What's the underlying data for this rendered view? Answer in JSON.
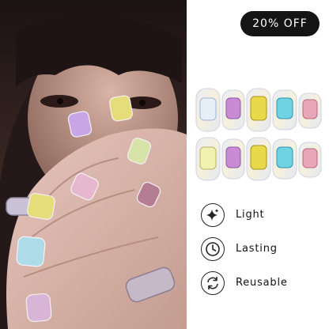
{
  "badge": {
    "text": "20% OFF"
  },
  "features": [
    {
      "icon": "sparkle-icon",
      "label": "Light"
    },
    {
      "icon": "clock-icon",
      "label": "Lasting"
    },
    {
      "icon": "refresh-icon",
      "label": "Reusable"
    }
  ],
  "colors": {
    "badge_bg": "#141414",
    "gem_yellow": "#e9d84a",
    "gem_purple": "#c98bd6",
    "gem_cyan": "#6fd3e3",
    "gem_pink": "#e8a6b8"
  },
  "product": {
    "rows": [
      {
        "gems": [
          "clear-iridescent",
          "purple",
          "yellow",
          "cyan",
          "pink"
        ]
      },
      {
        "gems": [
          "clear-iridescent",
          "purple",
          "yellow",
          "cyan",
          "pink"
        ]
      }
    ]
  }
}
